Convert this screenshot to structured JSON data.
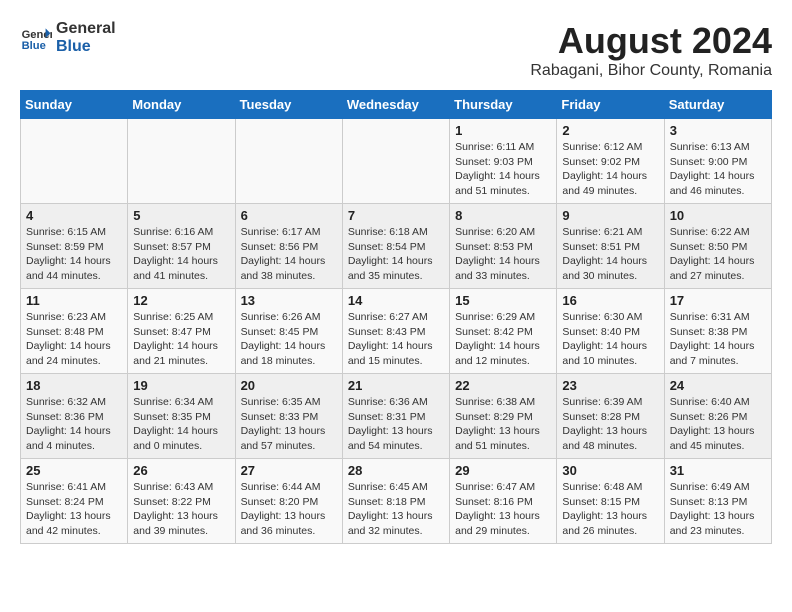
{
  "header": {
    "logo_general": "General",
    "logo_blue": "Blue",
    "main_title": "August 2024",
    "subtitle": "Rabagani, Bihor County, Romania"
  },
  "weekdays": [
    "Sunday",
    "Monday",
    "Tuesday",
    "Wednesday",
    "Thursday",
    "Friday",
    "Saturday"
  ],
  "weeks": [
    [
      {
        "day": "",
        "details": ""
      },
      {
        "day": "",
        "details": ""
      },
      {
        "day": "",
        "details": ""
      },
      {
        "day": "",
        "details": ""
      },
      {
        "day": "1",
        "details": "Sunrise: 6:11 AM\nSunset: 9:03 PM\nDaylight: 14 hours\nand 51 minutes."
      },
      {
        "day": "2",
        "details": "Sunrise: 6:12 AM\nSunset: 9:02 PM\nDaylight: 14 hours\nand 49 minutes."
      },
      {
        "day": "3",
        "details": "Sunrise: 6:13 AM\nSunset: 9:00 PM\nDaylight: 14 hours\nand 46 minutes."
      }
    ],
    [
      {
        "day": "4",
        "details": "Sunrise: 6:15 AM\nSunset: 8:59 PM\nDaylight: 14 hours\nand 44 minutes."
      },
      {
        "day": "5",
        "details": "Sunrise: 6:16 AM\nSunset: 8:57 PM\nDaylight: 14 hours\nand 41 minutes."
      },
      {
        "day": "6",
        "details": "Sunrise: 6:17 AM\nSunset: 8:56 PM\nDaylight: 14 hours\nand 38 minutes."
      },
      {
        "day": "7",
        "details": "Sunrise: 6:18 AM\nSunset: 8:54 PM\nDaylight: 14 hours\nand 35 minutes."
      },
      {
        "day": "8",
        "details": "Sunrise: 6:20 AM\nSunset: 8:53 PM\nDaylight: 14 hours\nand 33 minutes."
      },
      {
        "day": "9",
        "details": "Sunrise: 6:21 AM\nSunset: 8:51 PM\nDaylight: 14 hours\nand 30 minutes."
      },
      {
        "day": "10",
        "details": "Sunrise: 6:22 AM\nSunset: 8:50 PM\nDaylight: 14 hours\nand 27 minutes."
      }
    ],
    [
      {
        "day": "11",
        "details": "Sunrise: 6:23 AM\nSunset: 8:48 PM\nDaylight: 14 hours\nand 24 minutes."
      },
      {
        "day": "12",
        "details": "Sunrise: 6:25 AM\nSunset: 8:47 PM\nDaylight: 14 hours\nand 21 minutes."
      },
      {
        "day": "13",
        "details": "Sunrise: 6:26 AM\nSunset: 8:45 PM\nDaylight: 14 hours\nand 18 minutes."
      },
      {
        "day": "14",
        "details": "Sunrise: 6:27 AM\nSunset: 8:43 PM\nDaylight: 14 hours\nand 15 minutes."
      },
      {
        "day": "15",
        "details": "Sunrise: 6:29 AM\nSunset: 8:42 PM\nDaylight: 14 hours\nand 12 minutes."
      },
      {
        "day": "16",
        "details": "Sunrise: 6:30 AM\nSunset: 8:40 PM\nDaylight: 14 hours\nand 10 minutes."
      },
      {
        "day": "17",
        "details": "Sunrise: 6:31 AM\nSunset: 8:38 PM\nDaylight: 14 hours\nand 7 minutes."
      }
    ],
    [
      {
        "day": "18",
        "details": "Sunrise: 6:32 AM\nSunset: 8:36 PM\nDaylight: 14 hours\nand 4 minutes."
      },
      {
        "day": "19",
        "details": "Sunrise: 6:34 AM\nSunset: 8:35 PM\nDaylight: 14 hours\nand 0 minutes."
      },
      {
        "day": "20",
        "details": "Sunrise: 6:35 AM\nSunset: 8:33 PM\nDaylight: 13 hours\nand 57 minutes."
      },
      {
        "day": "21",
        "details": "Sunrise: 6:36 AM\nSunset: 8:31 PM\nDaylight: 13 hours\nand 54 minutes."
      },
      {
        "day": "22",
        "details": "Sunrise: 6:38 AM\nSunset: 8:29 PM\nDaylight: 13 hours\nand 51 minutes."
      },
      {
        "day": "23",
        "details": "Sunrise: 6:39 AM\nSunset: 8:28 PM\nDaylight: 13 hours\nand 48 minutes."
      },
      {
        "day": "24",
        "details": "Sunrise: 6:40 AM\nSunset: 8:26 PM\nDaylight: 13 hours\nand 45 minutes."
      }
    ],
    [
      {
        "day": "25",
        "details": "Sunrise: 6:41 AM\nSunset: 8:24 PM\nDaylight: 13 hours\nand 42 minutes."
      },
      {
        "day": "26",
        "details": "Sunrise: 6:43 AM\nSunset: 8:22 PM\nDaylight: 13 hours\nand 39 minutes."
      },
      {
        "day": "27",
        "details": "Sunrise: 6:44 AM\nSunset: 8:20 PM\nDaylight: 13 hours\nand 36 minutes."
      },
      {
        "day": "28",
        "details": "Sunrise: 6:45 AM\nSunset: 8:18 PM\nDaylight: 13 hours\nand 32 minutes."
      },
      {
        "day": "29",
        "details": "Sunrise: 6:47 AM\nSunset: 8:16 PM\nDaylight: 13 hours\nand 29 minutes."
      },
      {
        "day": "30",
        "details": "Sunrise: 6:48 AM\nSunset: 8:15 PM\nDaylight: 13 hours\nand 26 minutes."
      },
      {
        "day": "31",
        "details": "Sunrise: 6:49 AM\nSunset: 8:13 PM\nDaylight: 13 hours\nand 23 minutes."
      }
    ]
  ]
}
